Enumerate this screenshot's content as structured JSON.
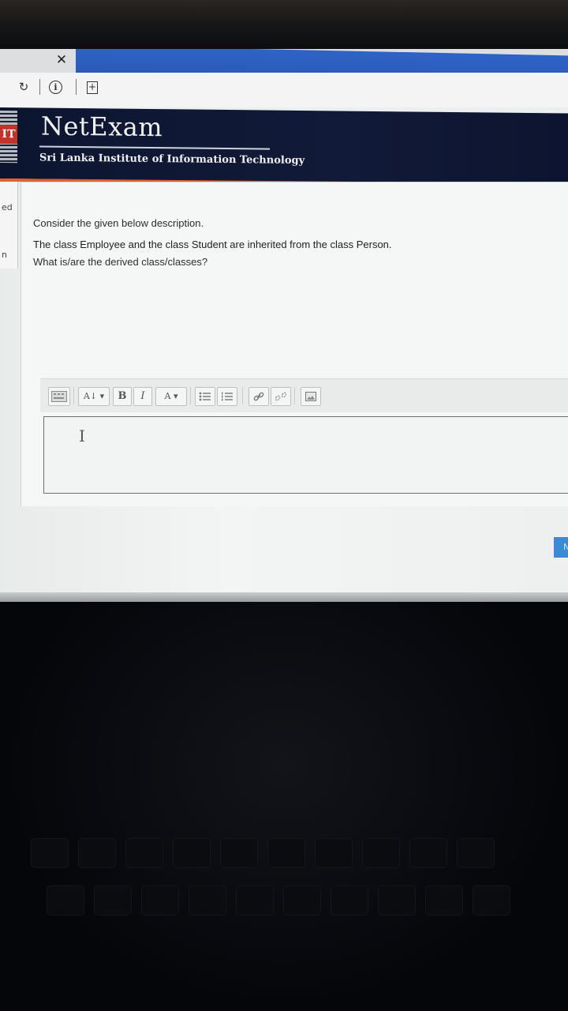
{
  "browser": {
    "close_glyph": "✕",
    "reload_glyph": "↻",
    "info_glyph": "i",
    "newtab_glyph": "+"
  },
  "banner": {
    "logo_letters": "IT",
    "brand": "NetExam",
    "institute": "Sri Lanka Institute of Information Technology"
  },
  "sidebar_stub": {
    "item1": "ed",
    "item2": "n"
  },
  "question": {
    "line1": "Consider the given below description.",
    "line2": "The class Employee and the class Student are inherited from the class Person.",
    "line3": "What is/are the derived class/classes?"
  },
  "toolbar": {
    "font_size": "A↓ ▾",
    "bold": "B",
    "italic": "I",
    "text_color": "A ▾",
    "unordered_list_icon": "bullet-list-icon",
    "ordered_list_icon": "numbered-list-icon",
    "link_icon": "link-icon",
    "unlink_icon": "unlink-icon",
    "image_icon": "image-icon"
  },
  "editor": {
    "cursor_glyph": "I"
  },
  "next_button": {
    "label": "N"
  },
  "colors": {
    "banner_bg": "#111a38",
    "accent_orange": "#e2602e",
    "button_blue": "#3b8ad6"
  }
}
